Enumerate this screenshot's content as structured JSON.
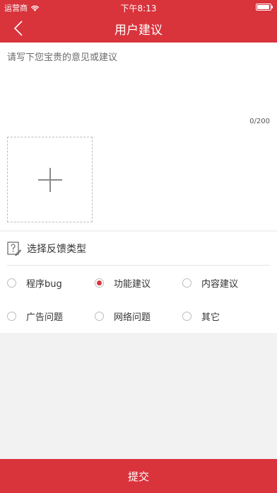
{
  "status_bar": {
    "carrier": "运营商",
    "time": "下午8:13"
  },
  "nav": {
    "title": "用户建议"
  },
  "editor": {
    "placeholder": "请写下您宝贵的意见或建议",
    "counter": "0/200"
  },
  "feedback": {
    "heading": "选择反馈类型",
    "options": [
      {
        "label": "程序bug",
        "selected": false
      },
      {
        "label": "功能建议",
        "selected": true
      },
      {
        "label": "内容建议",
        "selected": false
      },
      {
        "label": "广告问题",
        "selected": false
      },
      {
        "label": "网络问题",
        "selected": false
      },
      {
        "label": "其它",
        "selected": false
      }
    ]
  },
  "submit": {
    "label": "提交"
  },
  "colors": {
    "accent": "#d9333c",
    "background": "#f2f2f2"
  }
}
